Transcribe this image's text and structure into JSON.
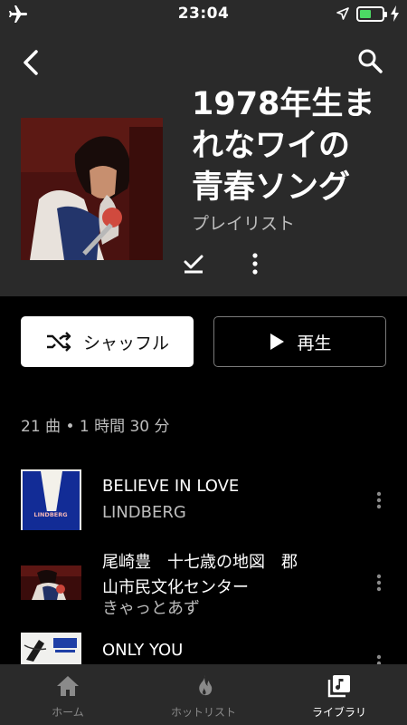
{
  "status": {
    "time": "23:04"
  },
  "playlist": {
    "title": "1978年生まれなワイの青春ソング",
    "title_lines": [
      "1978年生ま",
      "れなワイの",
      "青春ソング"
    ],
    "type": "プレイリスト"
  },
  "actions": {
    "shuffle": "シャッフル",
    "play": "再生"
  },
  "meta": "21 曲 • 1 時間 30 分",
  "tracks": [
    {
      "title": "BELIEVE IN LOVE",
      "artist": "LINDBERG"
    },
    {
      "title_lines": [
        "尾崎豊　十七歳の地図　郡",
        "山市民文化センター"
      ],
      "artist": "きゃっとあず"
    },
    {
      "title": "ONLY YOU"
    }
  ],
  "nav": [
    {
      "label": "ホーム",
      "icon": "home-icon"
    },
    {
      "label": "ホットリスト",
      "icon": "flame-icon"
    },
    {
      "label": "ライブラリ",
      "icon": "library-icon",
      "active": true
    }
  ],
  "colors": {
    "header_bg": "#2a2a2a",
    "background": "#000000",
    "battery": "#4cd964"
  }
}
